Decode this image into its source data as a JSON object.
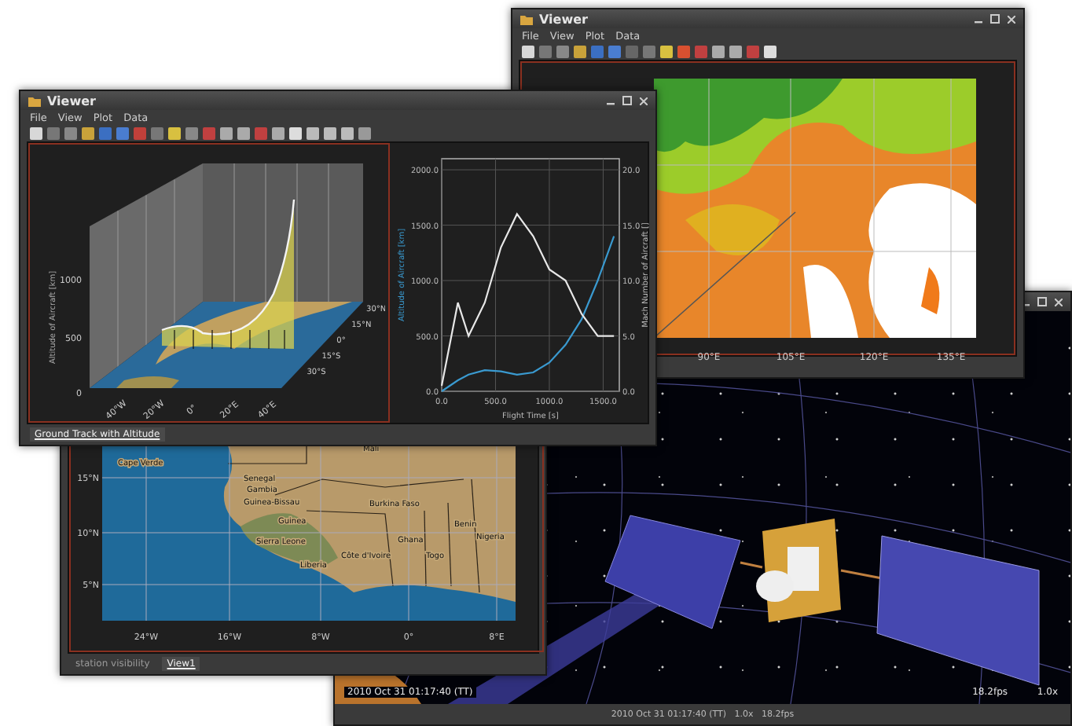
{
  "satellite_view": {
    "time_overlay": "2010 Oct 31 01:17:40 (TT)",
    "fps": "18.2fps",
    "speed": "1.0x",
    "status": "2010 Oct 31 01:17:40 (TT)   1.0x   18.2fps"
  },
  "map_viewer": {
    "title": "Viewer",
    "menu": [
      "File",
      "View",
      "Plot",
      "Data"
    ],
    "lon_ticks": [
      "90°E",
      "105°E",
      "120°E",
      "135°E"
    ]
  },
  "africa_viewer": {
    "lat_ticks": [
      "15°N",
      "10°N",
      "5°N"
    ],
    "lon_ticks": [
      "24°W",
      "16°W",
      "8°W",
      "0°",
      "8°E"
    ],
    "places": [
      "Mali",
      "Cape Verde",
      "Senegal",
      "Gambia",
      "Guinea-Bissau",
      "Guinea",
      "Sierra Leone",
      "Liberia",
      "Côte d'Ivoire",
      "Burkina Faso",
      "Ghana",
      "Togo",
      "Benin",
      "Nigeria"
    ],
    "tabs": [
      {
        "label": "station visibility",
        "selected": false
      },
      {
        "label": "View1",
        "selected": true
      }
    ]
  },
  "main_viewer": {
    "title": "Viewer",
    "menu": [
      "File",
      "View",
      "Plot",
      "Data"
    ],
    "surface_plot": {
      "zlabel": "Altitude of Aircraft [km]",
      "zticks": [
        "1000",
        "500",
        "0"
      ],
      "lon_ticks": [
        "40°W",
        "20°W",
        "0°",
        "20°E",
        "40°E"
      ],
      "lat_ticks": [
        "30°N",
        "15°N",
        "0°",
        "15°S",
        "30°S"
      ]
    },
    "line_plot": {
      "chart_data": {
        "type": "line",
        "grid": true,
        "xlabel": "Flight Time [s]",
        "ylabel": "Altitude of Aircraft [km]",
        "y2label": "Mach Number of Aircraft []",
        "y2lim": [
          0,
          21
        ],
        "y2ticks": [
          {
            "value": 0,
            "label": "0.0"
          },
          {
            "value": 5,
            "label": "5.0"
          },
          {
            "value": 10,
            "label": "10.0"
          },
          {
            "value": 15,
            "label": "15.0"
          },
          {
            "value": 20,
            "label": "20.0"
          }
        ],
        "x": [
          0,
          150,
          250,
          400,
          550,
          700,
          850,
          1000,
          1150,
          1300,
          1450,
          1600
        ],
        "xlim": [
          0,
          1650
        ],
        "ylim": [
          0,
          2100
        ],
        "xticks": [
          {
            "value": 0,
            "label": "0.0"
          },
          {
            "value": 500,
            "label": "500.0"
          },
          {
            "value": 1000,
            "label": "1000.0"
          },
          {
            "value": 1500,
            "label": "1500.0"
          }
        ],
        "yticks": [
          {
            "value": 0,
            "label": "0.0"
          },
          {
            "value": 500,
            "label": "500.0"
          },
          {
            "value": 1000,
            "label": "1000.0"
          },
          {
            "value": 1500,
            "label": "1500.0"
          },
          {
            "value": 2000,
            "label": "2000.0"
          }
        ],
        "series": [
          {
            "color": "#3a9ad0",
            "values": [
              0,
              100,
              150,
              190,
              180,
              150,
              170,
              260,
              420,
              650,
              1000,
              1400
            ]
          },
          {
            "color": "#e8e8e8",
            "axis": "y2",
            "values": [
              0.5,
              8,
              5,
              8,
              13,
              16,
              14,
              11,
              10,
              7,
              5,
              5
            ]
          }
        ]
      }
    },
    "tabs": [
      {
        "label": "Ground Track with Altitude",
        "selected": true
      }
    ]
  }
}
